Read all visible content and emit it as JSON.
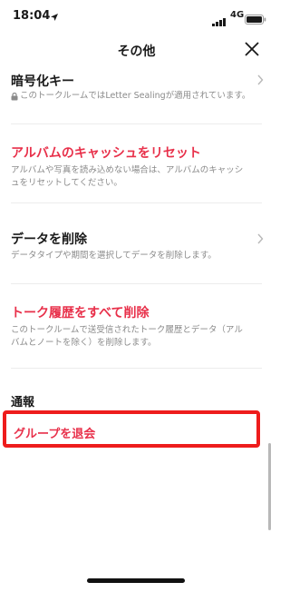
{
  "status_bar": {
    "time": "18:04",
    "network": "4G"
  },
  "header": {
    "title": "その他"
  },
  "items": [
    {
      "title": "暗号化キー",
      "desc": "このトークルームではLetter Sealingが適用されています。"
    },
    {
      "title": "アルバムのキャッシュをリセット",
      "desc": "アルバムや写真を読み込めない場合は、アルバムのキャッシュをリセットしてください。"
    },
    {
      "title": "データを削除",
      "desc": "データタイプや期間を選択してデータを削除します。"
    },
    {
      "title": "トーク履歴をすべて削除",
      "desc": "このトークルームで送受信されたトーク履歴とデータ（アルバムとノートを除く）を削除します。"
    }
  ],
  "section": {
    "label": "通報"
  },
  "leave": {
    "label": "グループを退会"
  },
  "colors": {
    "accent_red": "#e8304a",
    "highlight_border": "#ee1c1c"
  }
}
